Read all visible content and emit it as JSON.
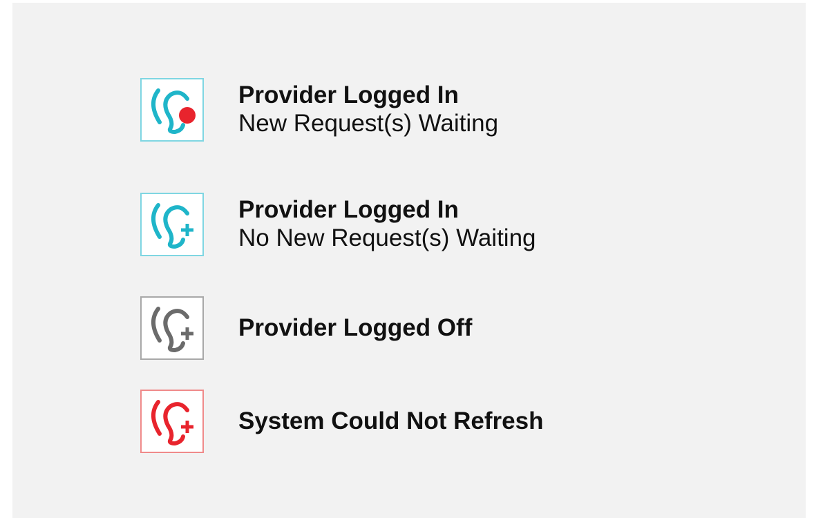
{
  "legend": {
    "items": [
      {
        "title": "Provider Logged In",
        "subtitle": "New Request(s) Waiting",
        "icon": "hearing-ear-icon-with-red-dot",
        "color": "#1fb5c9",
        "border_color": "#7fd6e2",
        "badge": "dot",
        "badge_color": "#e8242d"
      },
      {
        "title": "Provider Logged In",
        "subtitle": "No New Request(s) Waiting",
        "icon": "hearing-ear-icon-with-plus",
        "color": "#1fb5c9",
        "border_color": "#7fd6e2",
        "badge": "plus",
        "badge_color": "#1fb5c9"
      },
      {
        "title": "Provider Logged Off",
        "subtitle": "",
        "icon": "hearing-ear-icon-with-plus-gray",
        "color": "#6b6b6b",
        "border_color": "#a8a8a8",
        "badge": "plus",
        "badge_color": "#6b6b6b"
      },
      {
        "title": "System Could Not Refresh",
        "subtitle": "",
        "icon": "hearing-ear-icon-with-plus-red",
        "color": "#e8242d",
        "border_color": "#f08a8a",
        "badge": "plus",
        "badge_color": "#e8242d"
      }
    ]
  }
}
